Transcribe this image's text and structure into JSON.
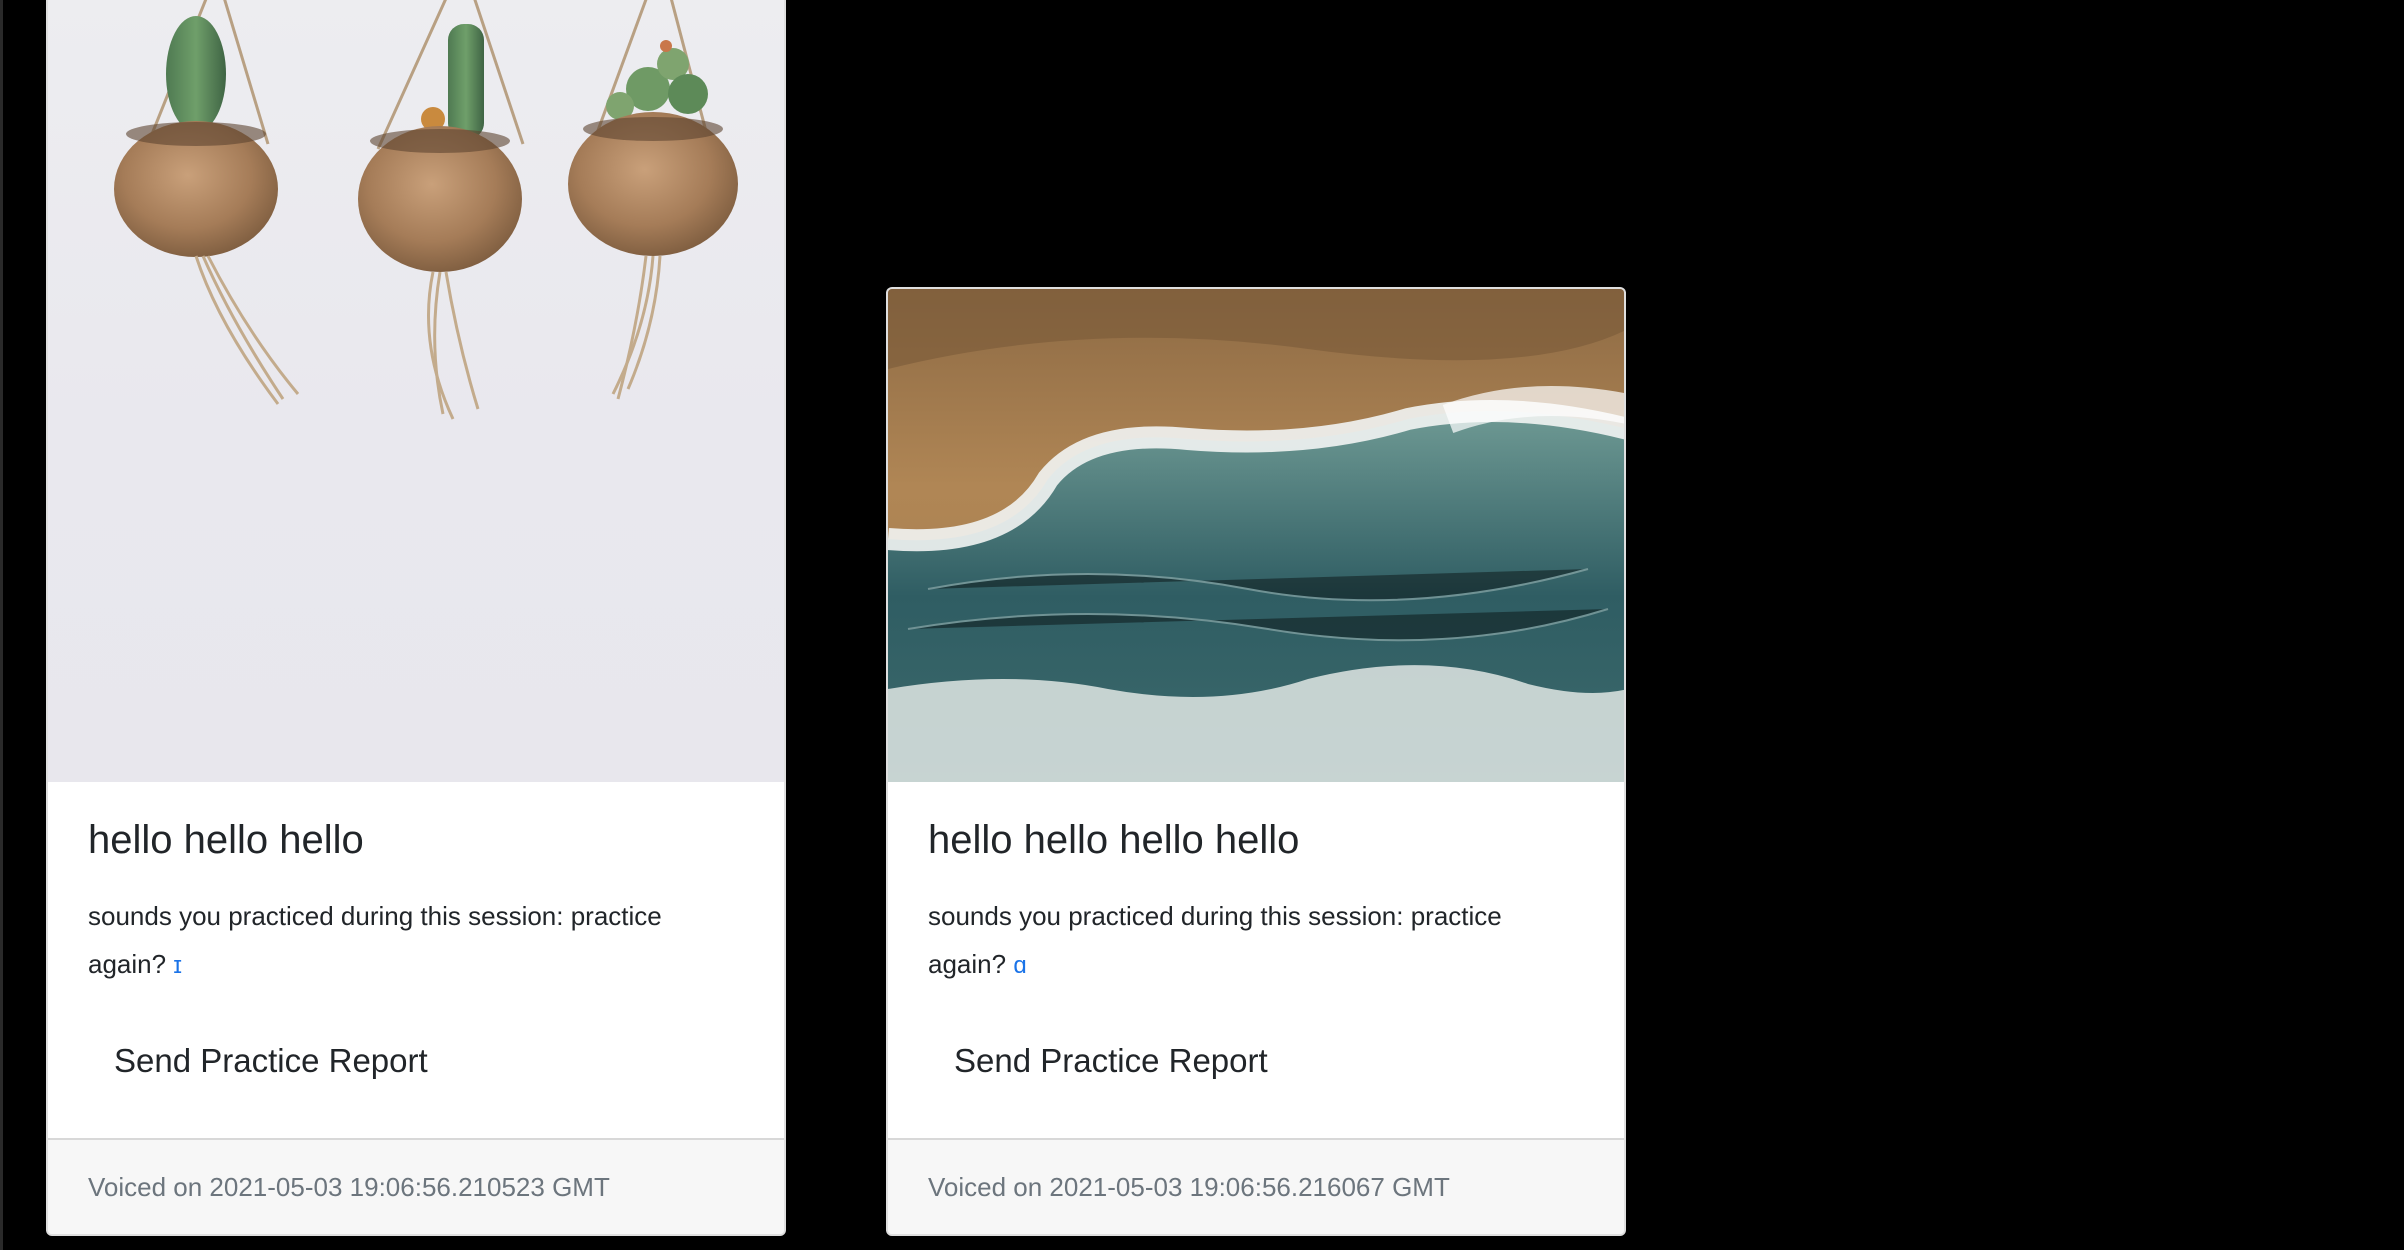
{
  "cards": [
    {
      "image": {
        "alt": "three hanging cactus planters",
        "background": "#ebeaef"
      },
      "title": "hello hello hello",
      "text": "sounds you practiced during this session: practice again?",
      "sound_link": "ɪ",
      "button_label": "Send Practice Report",
      "footer": "Voiced on 2021-05-03 19:06:56.210523 GMT"
    },
    {
      "image": {
        "alt": "aerial view of ocean waves on a sandy beach",
        "background": "#5a7f80"
      },
      "title": "hello hello hello hello",
      "text": "sounds you practiced during this session: practice again?",
      "sound_link": "ɑ",
      "button_label": "Send Practice Report",
      "footer": "Voiced on 2021-05-03 19:06:56.216067 GMT"
    }
  ],
  "colors": {
    "page_background": "#000000",
    "link": "#1a73e8",
    "footer_background": "#f7f7f7",
    "footer_text": "#6c757d"
  }
}
